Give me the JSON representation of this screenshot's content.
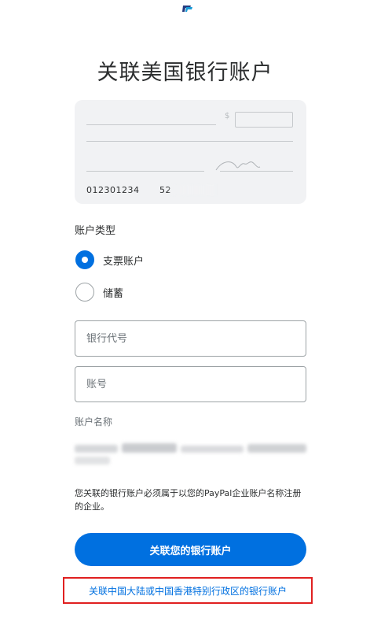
{
  "header": {
    "logo_icon": "paypal-logo-icon",
    "title": "关联美国银行账户"
  },
  "check_illustration": {
    "icon": "check-illustration",
    "routing_number": "012301234",
    "account_number_partial": "52"
  },
  "account_type": {
    "label": "账户类型",
    "options": [
      {
        "label": "支票账户",
        "selected": true
      },
      {
        "label": "储蓄",
        "selected": false
      }
    ]
  },
  "form": {
    "routing_placeholder": "银行代号",
    "account_placeholder": "账号",
    "account_name_label": "账户名称"
  },
  "notice": "您关联的银行账户必须属于以您的PayPal企业账户名称注册的企业。",
  "actions": {
    "submit_label": "关联您的银行账户",
    "alt_link_label": "关联中国大陆或中国香港特别行政区的银行账户"
  },
  "colors": {
    "accent": "#0070e0",
    "highlight_border": "#e02020",
    "card_bg": "#f1f2f4"
  }
}
